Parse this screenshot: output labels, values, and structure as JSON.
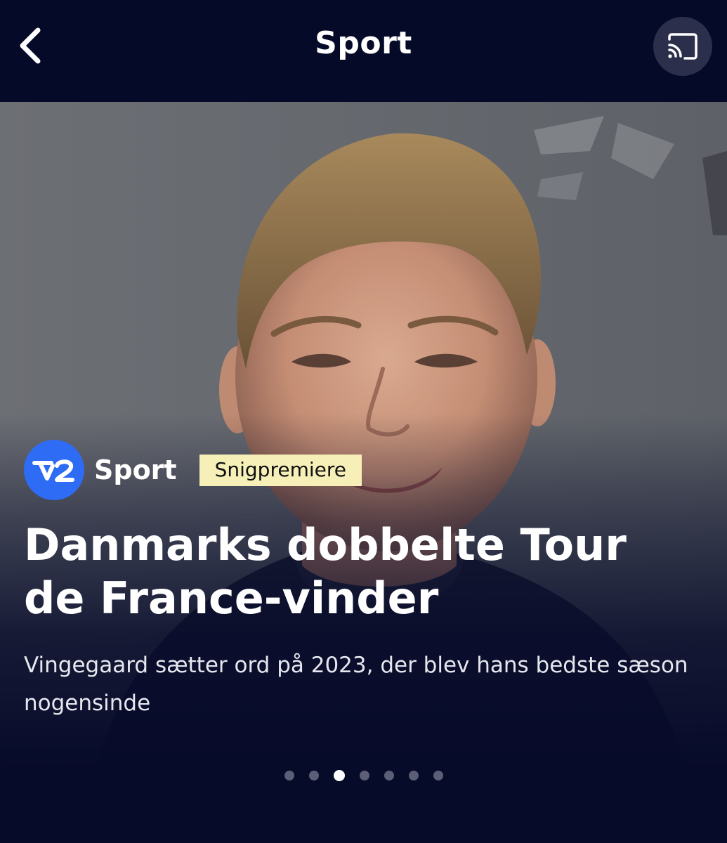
{
  "header": {
    "title": "Sport",
    "back_icon": "chevron-left-icon",
    "cast_icon": "cast-icon"
  },
  "hero": {
    "image": "portrait-photo",
    "brand": {
      "logo_text": "TV2",
      "name": "Sport",
      "logo_color": "#2e6cf5"
    },
    "badge": "Snigpremiere",
    "badge_color": "#f6efb8",
    "headline": "Danmarks dobbelte Tour de France-vinder",
    "subtitle": "Vingegaard sætter ord på 2023, der blev hans bedste sæson nogensinde"
  },
  "pager": {
    "total": 7,
    "active_index": 2
  },
  "colors": {
    "background": "#070b2a",
    "header": "#050a28",
    "text": "#ffffff"
  }
}
